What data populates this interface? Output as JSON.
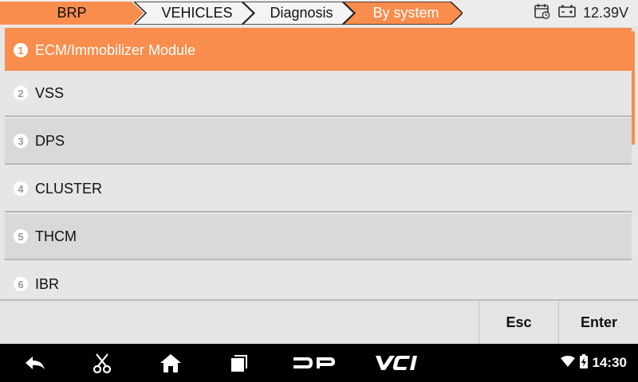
{
  "breadcrumb": [
    "BRP",
    "VEHICLES",
    "Diagnosis",
    "By system"
  ],
  "status": {
    "voltage": "12.39V",
    "calendar_icon": "calendar-clock-icon",
    "battery_icon": "car-battery-icon"
  },
  "list": {
    "items": [
      {
        "num": "1",
        "label": "ECM/Immobilizer Module",
        "selected": true
      },
      {
        "num": "2",
        "label": "VSS"
      },
      {
        "num": "3",
        "label": "DPS"
      },
      {
        "num": "4",
        "label": "CLUSTER"
      },
      {
        "num": "5",
        "label": "THCM"
      },
      {
        "num": "6",
        "label": "IBR"
      }
    ]
  },
  "buttons": {
    "esc": "Esc",
    "enter": "Enter"
  },
  "system": {
    "time": "14:30",
    "dp_label": "DP",
    "vci_label": "VCI"
  },
  "colors": {
    "accent": "#f98d4d",
    "row_light": "#e6e6e6",
    "row_dark": "#d9d9d9"
  }
}
